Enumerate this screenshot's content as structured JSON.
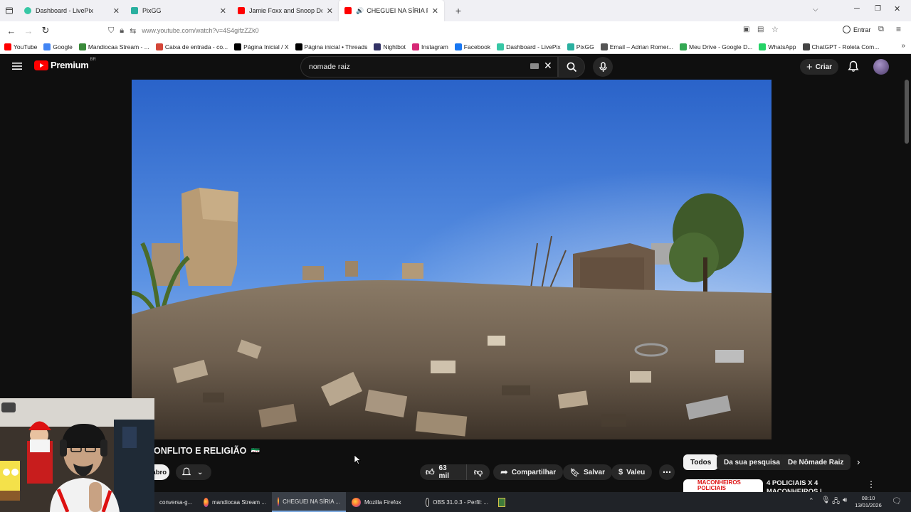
{
  "browser": {
    "tabs": [
      {
        "label": "Dashboard - LivePix",
        "icon": "livepix-icon",
        "color": "#37c7a5",
        "active": false
      },
      {
        "label": "PixGG",
        "icon": "pixgg-icon",
        "color": "#2ab0a0",
        "active": false
      },
      {
        "label": "Jamie Foxx and Snoop Dogg - F",
        "icon": "youtube-icon",
        "color": "#ff0000",
        "active": false
      },
      {
        "label": "CHEGUEI NA SÍRIA PAÍS DE",
        "icon": "youtube-icon",
        "color": "#ff0000",
        "active": true
      }
    ],
    "new_tab_symbol": "+",
    "url": "www.youtube.com/watch?v=4S4gifzZZk0",
    "signin_label": "Entrar",
    "bookmarks": [
      {
        "label": "YouTube",
        "color": "#ff0000"
      },
      {
        "label": "Google",
        "color": "#4285f4"
      },
      {
        "label": "Mandiocaa Stream - ...",
        "color": "#3a8a3a"
      },
      {
        "label": "Caixa de entrada - co...",
        "color": "#d44638"
      },
      {
        "label": "Página Inicial / X",
        "color": "#000000"
      },
      {
        "label": "Página inicial • Threads",
        "color": "#000000"
      },
      {
        "label": "Nightbot",
        "color": "#333366"
      },
      {
        "label": "Instagram",
        "color": "#d62976"
      },
      {
        "label": "Facebook",
        "color": "#1877f2"
      },
      {
        "label": "Dashboard - LivePix",
        "color": "#37c7a5"
      },
      {
        "label": "PixGG",
        "color": "#2ab0a0"
      },
      {
        "label": "Email – Adrian Romer...",
        "color": "#555555"
      },
      {
        "label": "Meu Drive - Google D...",
        "color": "#34a853"
      },
      {
        "label": "WhatsApp",
        "color": "#25d366"
      },
      {
        "label": "ChatGPT - Roleta Com...",
        "color": "#444444"
      }
    ]
  },
  "youtube": {
    "logo_text": "Premium",
    "logo_region": "BR",
    "search_query": "nomade raiz",
    "create_label": "Criar",
    "video_title": "ONFLITO E RELIGIÃO",
    "title_flag": "🇸🇾",
    "subscribe_label": "abro",
    "likes": "63 mil",
    "share_label": "Compartilhar",
    "save_label": "Salvar",
    "thanks_label": "Valeu",
    "chips": [
      "Todos",
      "Da sua pesquisa",
      "De Nômade Raiz"
    ],
    "rec_thumb_text": "MACONHEIROS POLICIAIS",
    "rec_title": "4 POLICIAIS X 4 MACONHEIROS |"
  },
  "taskbar": {
    "items": [
      {
        "label": "conversa-g...",
        "icon": "",
        "active": false
      },
      {
        "label": "mandiocaa Stream ...",
        "icon": "firefox-icon",
        "active": false
      },
      {
        "label": "CHEGUEI NA SÍRIA ...",
        "icon": "firefox-icon",
        "active": true
      },
      {
        "label": "Mozilla Firefox",
        "icon": "firefox-icon",
        "active": false
      },
      {
        "label": "OBS 31.0.3 - Perfil: ...",
        "icon": "obs-icon",
        "active": false
      }
    ],
    "time": "08:10",
    "date": "13/01/2026"
  },
  "colors": {
    "yt_red": "#ff0000",
    "yt_bg": "#0f0f0f",
    "pill_bg": "#272727",
    "chip_active_bg": "#f1f1f1"
  }
}
